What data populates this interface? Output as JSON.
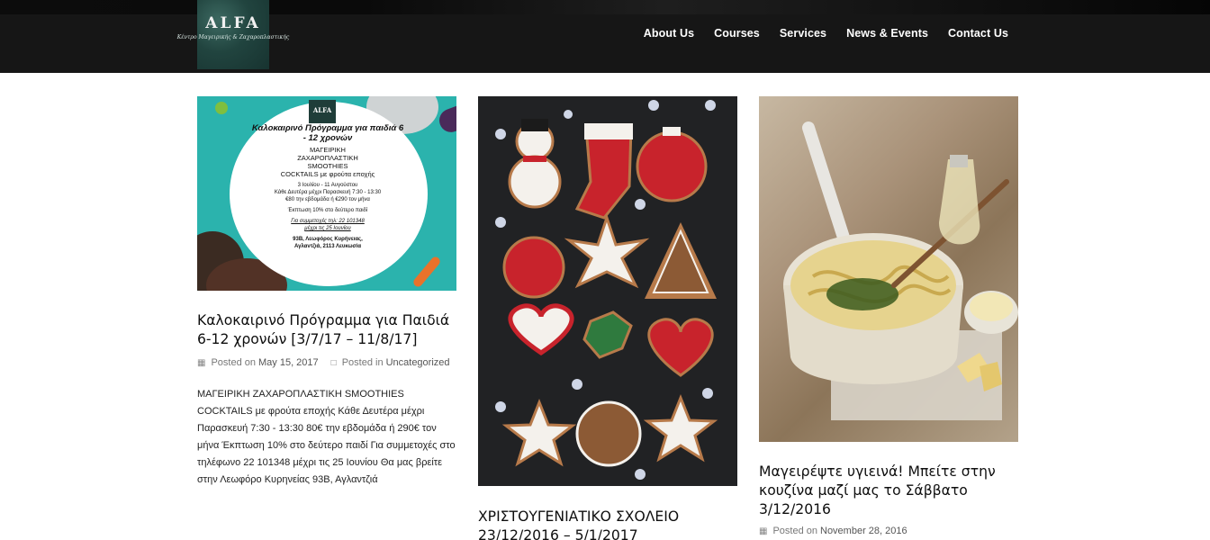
{
  "header": {
    "logo_text": "ALFA",
    "logo_tagline": "Κέντρο Μαγειρικής & Ζαχαροπλαστικής",
    "nav": [
      "About Us",
      "Courses",
      "Services",
      "News & Events",
      "Contact Us"
    ]
  },
  "posts": [
    {
      "title": "Καλοκαιρινό Πρόγραμμα για Παιδιά 6-12 χρονών [3/7/17 – 11/8/17]",
      "posted_label": "Posted on",
      "date": "May 15, 2017",
      "category_label": "Posted in",
      "category": "Uncategorized",
      "excerpt": "ΜΑΓΕΙΡΙΚΗ ΖΑΧΑΡΟΠΛΑΣΤΙΚΗ SMOOTHIES COCKTAILS με φρούτα εποχής Κάθε Δευτέρα μέχρι Παρασκευή 7:30 - 13:30 80€ την εβδομάδα ή 290€ τον μήνα Έκπτωση 10% στο δεύτερο παιδί Για συμμετοχές στο τηλέφωνο 22 101348 μέχρι τις 25 Ιουνίου Θα μας βρείτε στην Λεωφόρο Κυρηνείας 93Β, Αγλαντζιά",
      "image_alt": "Summer programme flyer",
      "flyer": {
        "logo": "ALFA",
        "heading": "Καλοκαιρινό Πρόγραμμα για παιδιά 6 - 12 χρονών",
        "lines": [
          "ΜΑΓΕΙΡΙΚΗ",
          "ΖΑΧΑΡΟΠΛΑΣΤΙΚΗ",
          "SMOOTHIES",
          "COCKTAILS με φρούτα εποχής"
        ],
        "details": [
          "3 Ιουλίου - 11 Αυγούστου",
          "Κάθε Δευτέρα μέχρι Παρασκευή 7:30 - 13:30",
          "€80 την εβδομάδα ή €290 τον μήνα",
          "Έκπτωση 10% στο δεύτερο παιδί",
          "Για συμμετοχές τηλ: 22 101348",
          "μέχρι τις 25 Ιουνίου",
          "93Β, Λεωφόρος Κυρήνειας,",
          "Αγλαντζιά, 2113 Λευκωσία"
        ]
      }
    },
    {
      "title": "ΧΡΙΣΤΟΥΓΕΝΙΑΤΙΚΟ ΣΧΟΛΕΙΟ 23/12/2016 – 5/1/2017",
      "image_alt": "Christmas cookies"
    },
    {
      "title": "Μαγειρέψτε υγιεινά! Μπείτε στην κουζίνα μαζί μας το Σάββατο 3/12/2016",
      "posted_label": "Posted on",
      "date": "November 28, 2016",
      "image_alt": "Pasta pot"
    }
  ],
  "colors": {
    "nav_bg": "#161616",
    "logo_bg": "#21443f",
    "flyer_teal": "#2bb3ad",
    "cookie_red": "#c8232c"
  }
}
